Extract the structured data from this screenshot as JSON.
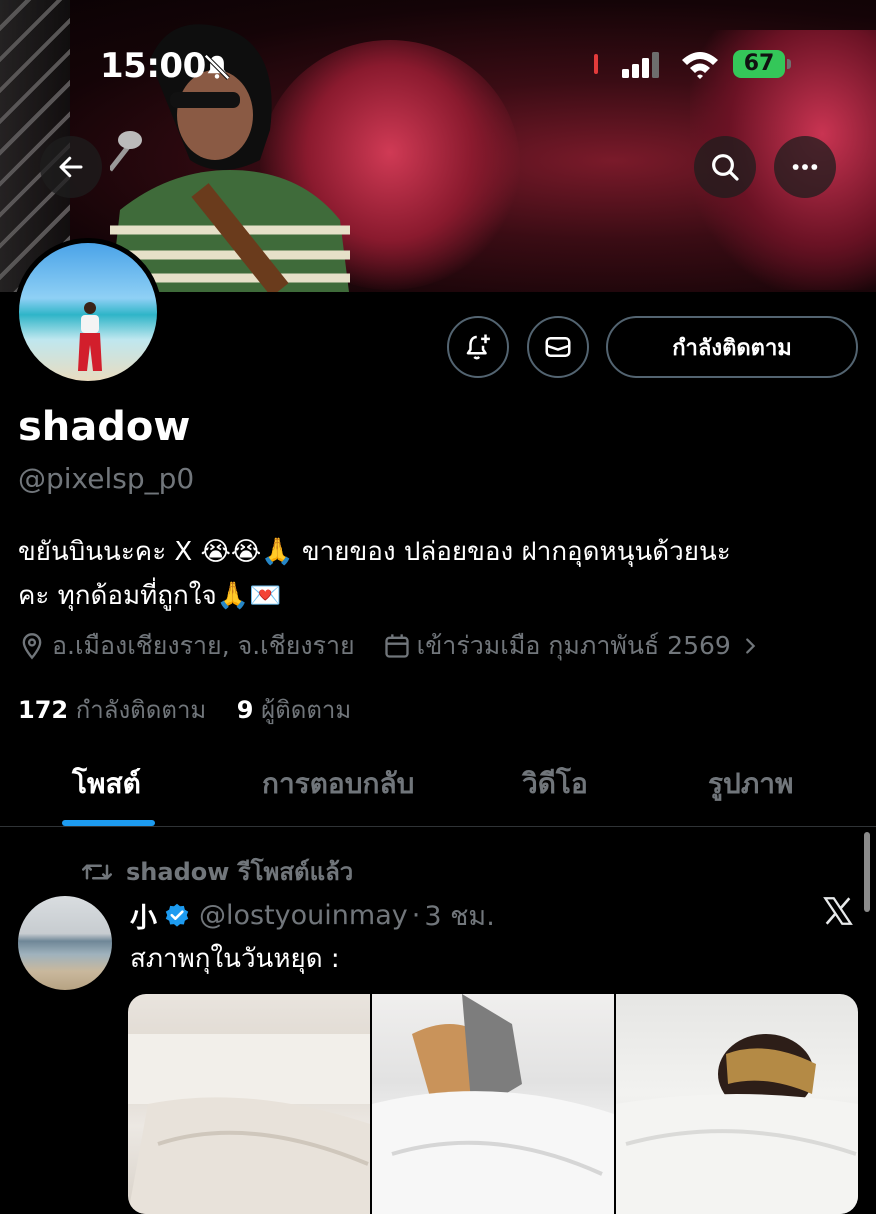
{
  "status_bar": {
    "time": "15:00",
    "battery": "67"
  },
  "profile": {
    "display_name": "shadow",
    "handle": "@pixelsp_p0",
    "follow_button": "กำลังติดตาม",
    "bio_line1": "ขยันบินนะคะ X 😭😭🙏 ขายของ ปล่อยของ ฝากอุดหนุนด้วยนะ",
    "bio_line2": "คะ ทุกด้อมที่ถูกใจ🙏💌",
    "location": "อ.เมืองเชียงราย, จ.เชียงราย",
    "joined": "เข้าร่วมเมือ กุมภาพันธ์ 2569",
    "following_count": "172",
    "following_label": "กำลังติดตาม",
    "followers_count": "9",
    "followers_label": "ผู้ติดตาม"
  },
  "tabs": [
    {
      "label": "โพสต์",
      "active": true
    },
    {
      "label": "การตอบกลับ",
      "active": false
    },
    {
      "label": "วิดีโอ",
      "active": false
    },
    {
      "label": "รูปภาพ",
      "active": false
    }
  ],
  "post": {
    "repost_label": "shadow รีโพสต์แล้ว",
    "author_name": "小",
    "author_handle": "@lostyouinmay",
    "separator": "·",
    "time_ago": "3 ชม.",
    "text": "สภาพกุในวันหยุด :"
  },
  "icons": {
    "back": "arrow-left-icon",
    "search": "search-icon",
    "more": "more-icon",
    "notify": "bell-plus-icon",
    "message": "envelope-icon",
    "location": "location-pin-icon",
    "calendar": "calendar-icon",
    "repost": "repost-icon",
    "verified": "verified-badge-icon",
    "x": "x-logo-icon"
  },
  "colors": {
    "accent": "#1d9bf0",
    "battery": "#34c759",
    "muted": "#71767b"
  }
}
